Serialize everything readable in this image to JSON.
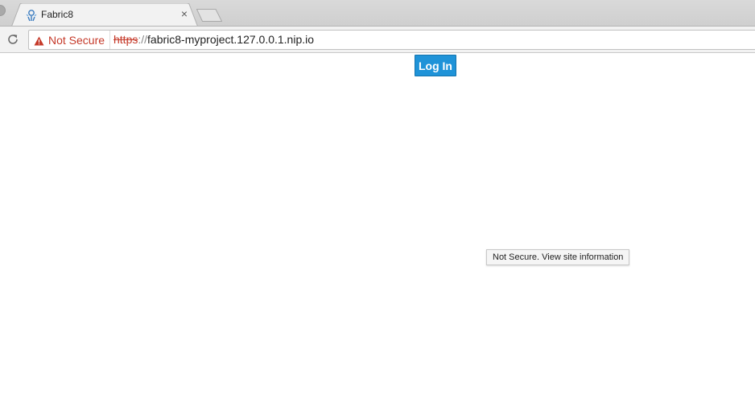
{
  "tab": {
    "title": "Fabric8",
    "close_glyph": "×",
    "favicon": "fabric8-favicon-icon"
  },
  "toolbar": {
    "reload_icon": "reload-icon",
    "security_label": "Not Secure",
    "security_icon": "warning-triangle-icon",
    "url_scheme": "https",
    "url_separator": "://",
    "url_host": "fabric8-myproject.127.0.0.1.nip.io"
  },
  "page": {
    "login_label": "Log In"
  },
  "tooltip": {
    "text": "Not Secure. View site information"
  },
  "colors": {
    "insecure_red": "#c53929",
    "login_blue": "#1f93d8"
  }
}
